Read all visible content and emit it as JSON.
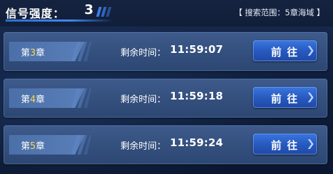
{
  "header": {
    "signal_label": "信号强度：",
    "signal_value": "3",
    "search_range": "【 搜索范围：5章海域 】"
  },
  "rows": [
    {
      "chapter_prefix": "第",
      "chapter_number": "3",
      "chapter_suffix": "章",
      "remain_label": "剩余时间：",
      "remain_time": "11:59:07",
      "button_label": "前往"
    },
    {
      "chapter_prefix": "第",
      "chapter_number": "4",
      "chapter_suffix": "章",
      "remain_label": "剩余时间：",
      "remain_time": "11:59:18",
      "button_label": "前往"
    },
    {
      "chapter_prefix": "第",
      "chapter_number": "5",
      "chapter_suffix": "章",
      "remain_label": "剩余时间：",
      "remain_time": "11:59:24",
      "button_label": "前往"
    }
  ],
  "colors": {
    "chapter_number": "#ffd84a",
    "row_bg": "#3a5686",
    "button_bg": "#2a62cc",
    "accent_line": "#3f8af2"
  },
  "icons": {
    "header_decoration": "diagonal-stripes-icon",
    "chapter_decoration": "diagonal-stripes-icon",
    "button_arrow": "chevron-right-icon"
  }
}
